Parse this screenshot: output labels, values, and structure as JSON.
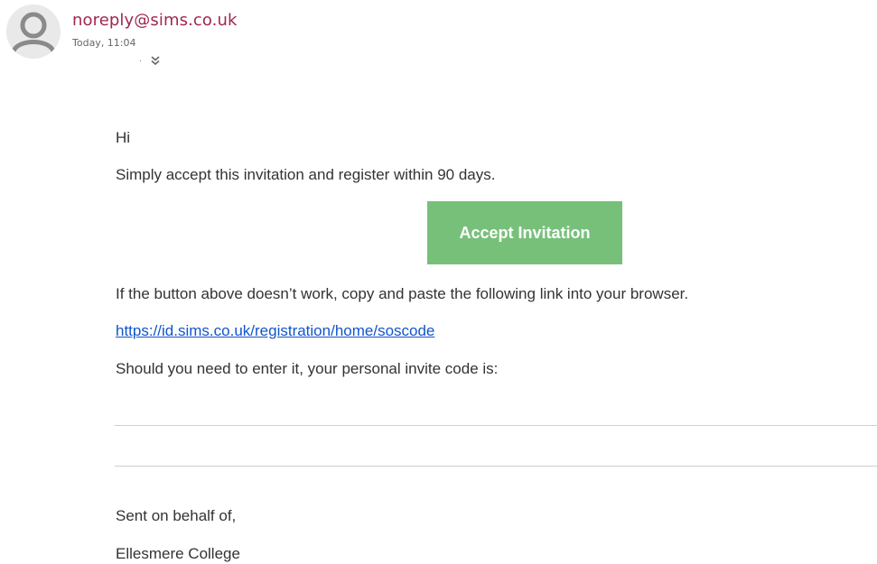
{
  "header": {
    "sender": "noreply@sims.co.uk",
    "date": "Today, 11:04",
    "recipient_separator": "·",
    "expand_icon": "double-chevron-down-icon"
  },
  "email": {
    "greeting": "Hi",
    "intro": "Simply accept this invitation and register within 90 days.",
    "button_label": "Accept Invitation",
    "fallback_text": "If the button above doesn’t work, copy and paste the following link into your browser.",
    "link": "https://id.sims.co.uk/registration/home/soscode",
    "code_text": "Should you need to enter it, your personal invite code is:",
    "signoff": "Sent on behalf of,",
    "organisation": "Ellesmere College"
  },
  "colors": {
    "sender": "#a0274f",
    "button": "#77c07a",
    "link": "#1155cc",
    "text": "#333333"
  }
}
